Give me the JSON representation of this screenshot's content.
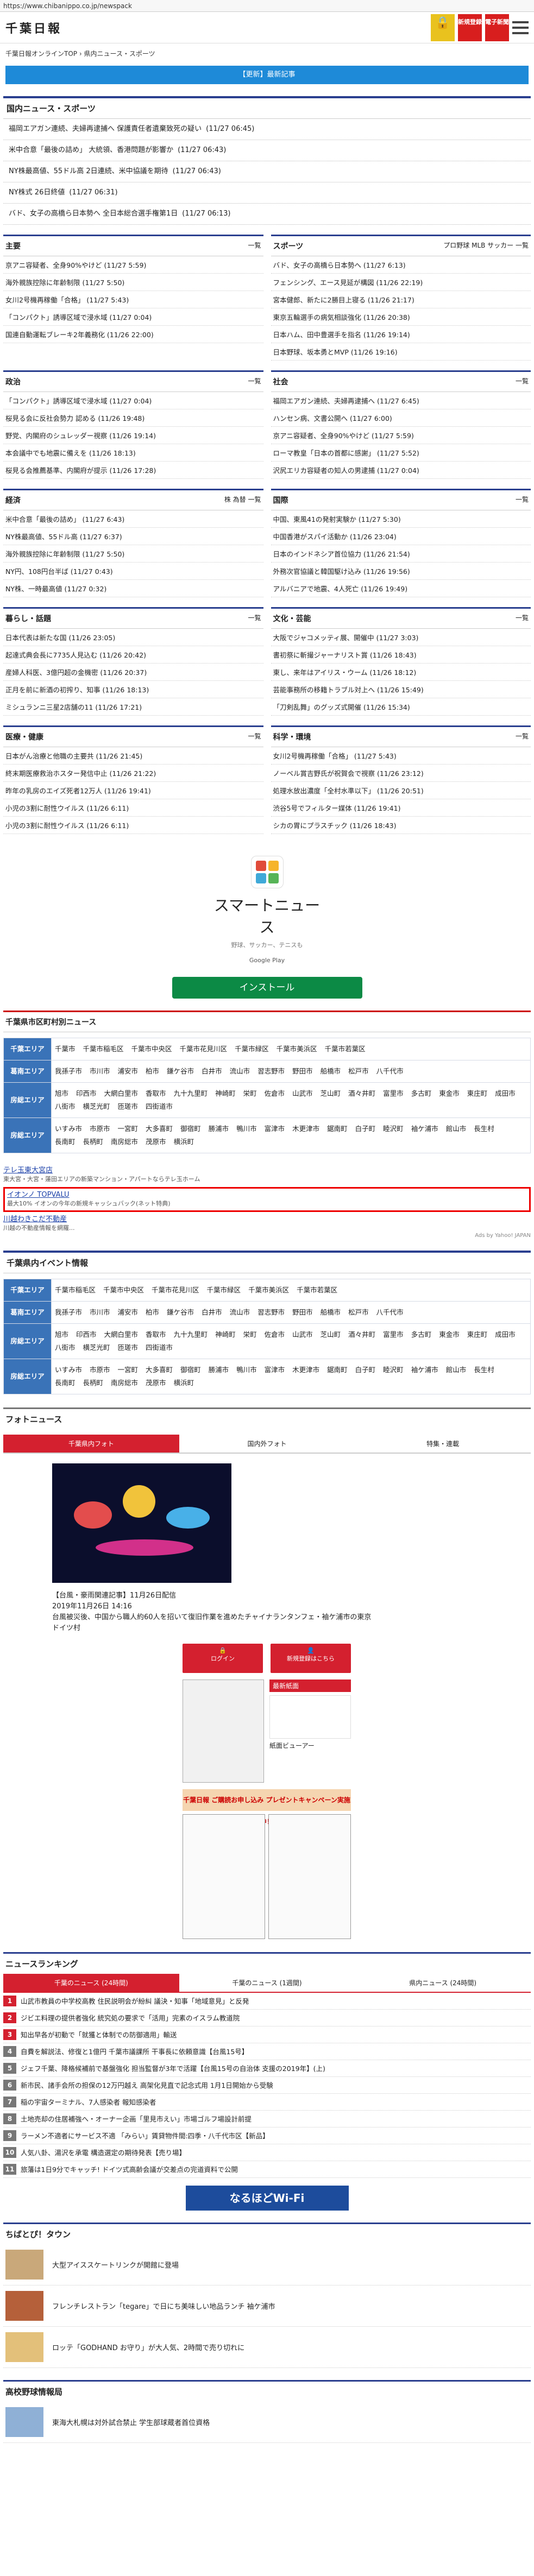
{
  "url": "https://www.chibanippo.co.jp/newspack",
  "logo": "千葉日報",
  "header": {
    "lock": "🔒",
    "register": "新規登録",
    "epaper": "電子新聞"
  },
  "breadcrumb": "千葉日報オンラインTOP › 県内ニュース・スポーツ",
  "banner": "【更新】最新記事",
  "domestic": {
    "title": "国内ニュース・スポーツ",
    "items": [
      {
        "t": "福岡エアガン連続、夫婦再逮捕へ 保護責任者遺棄致死の疑い",
        "d": "(11/27 06:45)"
      },
      {
        "t": "米中合意「最後の詰め」 大統領、香港問題が影響か",
        "d": "(11/27 06:43)"
      },
      {
        "t": "NY株最高値、55ドル高 2日連続、米中協議を期待",
        "d": "(11/27 06:43)"
      },
      {
        "t": "NY株式 26日終値",
        "d": "(11/27 06:31)"
      },
      {
        "t": "バド、女子の高橋ら日本勢へ 全日本総合選手権第1日",
        "d": "(11/27 06:13)"
      }
    ]
  },
  "cols": [
    [
      {
        "title": "主要",
        "more": "一覧",
        "items": [
          "京アニ容疑者、全身90%やけど (11/27 5:59)",
          "海外親族控除に年齢制限 (11/27 5:50)",
          "女川2号機再稼働「合格」 (11/27 5:43)",
          "「コンパクト」誘導区域で浸水域 (11/27 0:04)",
          "国連自動運転ブレーキ2年義務化 (11/26 22:00)"
        ]
      },
      {
        "title": "スポーツ",
        "more": "プロ野球 MLB サッカー 一覧",
        "items": [
          "バド、女子の高橋ら日本勢へ (11/27 6:13)",
          "フェンシング、エース見延が構図 (11/26 22:19)",
          "宮本健郎、新たに2勝目上寝る (11/26 21:17)",
          "東京五輪選手の病気相談強化 (11/26 20:38)",
          "日本ハム、田中豊選手を指名 (11/26 19:14)",
          "日本野球、坂本勇とMVP (11/26 19:16)"
        ]
      }
    ],
    [
      {
        "title": "政治",
        "more": "一覧",
        "items": [
          "「コンパクト」誘導区域で浸水域 (11/27 0:04)",
          "桜見る会に反社会勢力 認める (11/26 19:48)",
          "野党、内閣府のシュレッダー視察 (11/26 19:14)",
          "本会議中でも地震に備えを (11/26 18:13)",
          "桜見る会推薦基準、内閣府が提示 (11/26 17:28)"
        ]
      },
      {
        "title": "社会",
        "more": "一覧",
        "items": [
          "福岡エアガン連続、夫婦再逮捕へ (11/27 6:45)",
          "ハンセン病、文書公開へ (11/27 6:00)",
          "京アニ容疑者、全身90%やけど (11/27 5:59)",
          "ローマ教皇「日本の首都に感謝」 (11/27 5:52)",
          "沢尻エリカ容疑者の知人の男逮捕 (11/27 0:04)"
        ]
      }
    ],
    [
      {
        "title": "経済",
        "more": "株 為替 一覧",
        "items": [
          "米中合意「最後の詰め」 (11/27 6:43)",
          "NY株最高値、55ドル高 (11/27 6:37)",
          "海外親族控除に年齢制限 (11/27 5:50)",
          "NY円、108円台半ば (11/27 0:43)",
          "NY株、一時最高値 (11/27 0:32)"
        ]
      },
      {
        "title": "国際",
        "more": "一覧",
        "items": [
          "中国、東風41の発射実験か (11/27 5:30)",
          "中国香港がスパイ活動か (11/26 23:04)",
          "日本のインドネシア首位協力 (11/26 21:54)",
          "外務次官協議と韓国駆け込み (11/26 19:56)",
          "アルバニアで地震、4人死亡 (11/26 19:49)"
        ]
      }
    ],
    [
      {
        "title": "暮らし・話題",
        "more": "一覧",
        "items": [
          "日本代表は新たな国 (11/26 23:05)",
          "起達式典会長に7735人見込む (11/26 20:42)",
          "産婦人科医、3億円超の金機密 (11/26 20:37)",
          "正月を前に新酒の初搾り、知事 (11/26 18:13)",
          "ミシュランニ三星2店舗の11 (11/26 17:21)"
        ]
      },
      {
        "title": "文化・芸能",
        "more": "一覧",
        "items": [
          "大阪でジャコメッティ展、開催中 (11/27 3:03)",
          "書初祭に斬撮ジャーナリスト賞 (11/26 18:43)",
          "東し、来年はアイリス・ウーム (11/26 18:12)",
          "芸能事務所の移籍トラブル対上へ (11/26 15:49)",
          "「刀剣乱舞」のグッズ式開催 (11/26 15:34)"
        ]
      }
    ],
    [
      {
        "title": "医療・健康",
        "more": "一覧",
        "items": [
          "日本がん治療と他職の主要共 (11/26 21:45)",
          "終末期医療救治ホスター発信中止 (11/26 21:22)",
          "昨年の乳房のエイズ死者12万人 (11/26 19:41)",
          "小児の3割に耐性ウイルス (11/26 6:11)",
          "小児の3割に耐性ウイルス (11/26 6:11)"
        ]
      },
      {
        "title": "科学・環境",
        "more": "一覧",
        "items": [
          "女川2号機再稼働「合格」 (11/27 5:43)",
          "ノーベル賞吉野氏が祝賀会で視察 (11/26 23:12)",
          "処理水放出濃度「全村水準以下」 (11/26 20:51)",
          "渋谷5号でフィルター媒体 (11/26 19:41)",
          "シカの胃にプラスチック (11/26 18:43)"
        ]
      }
    ]
  ],
  "smartnews": {
    "title": "スマートニュース",
    "sub": "野球、サッカー、テニスも",
    "gplay": "Google Play",
    "install": "インストール"
  },
  "city": {
    "title": "千葉県市区町村別ニュース",
    "rows": [
      {
        "lab": "千葉エリア",
        "items": [
          "千葉市",
          "千葉市稲毛区",
          "千葉市中央区",
          "千葉市花見川区",
          "千葉市緑区",
          "千葉市美浜区",
          "千葉市若葉区"
        ]
      },
      {
        "lab": "葛南エリア",
        "items": [
          "我孫子市",
          "市川市",
          "浦安市",
          "柏市",
          "鎌ケ谷市",
          "白井市",
          "流山市",
          "習志野市",
          "野田市",
          "船橋市",
          "松戸市",
          "八千代市"
        ]
      },
      {
        "lab": "房総エリア",
        "items": [
          "旭市",
          "印西市",
          "大網白里市",
          "香取市",
          "九十九里町",
          "神崎町",
          "栄町",
          "佐倉市",
          "山武市",
          "芝山町",
          "酒々井町",
          "富里市",
          "多古町",
          "東金市",
          "東庄町",
          "成田市",
          "八街市",
          "横芝光町",
          "匝瑳市",
          "四街道市"
        ]
      },
      {
        "lab": "房総エリア",
        "items": [
          "いすみ市",
          "市原市",
          "一宮町",
          "大多喜町",
          "御宿町",
          "勝浦市",
          "鴨川市",
          "富津市",
          "木更津市",
          "鋸南町",
          "白子町",
          "睦沢町",
          "袖ケ浦市",
          "館山市",
          "長生村",
          "長南町",
          "長柄町",
          "南房総市",
          "茂原市",
          "横浜町"
        ]
      }
    ]
  },
  "sponsor": {
    "l1": "テレ玉東大宮店",
    "l1sub": "東大宮・大宮・蓮田エリアの新築マンション・アパートならテレ玉ホーム",
    "box1": "イオンノ TOPVALU",
    "box2": "最大10% イオンの今年の新規キャッシュバック(ネット特典)",
    "l3": "川越わきこだ不動産",
    "l3sub": "川越の不動産情報を網羅...",
    "adsby": "Ads by Yahoo! JAPAN"
  },
  "event": {
    "title": "千葉県内イベント情報",
    "rows": [
      {
        "lab": "千葉エリア",
        "items": [
          "千葉市稲毛区",
          "千葉市中央区",
          "千葉市花見川区",
          "千葉市緑区",
          "千葉市美浜区",
          "千葉市若葉区"
        ]
      },
      {
        "lab": "葛南エリア",
        "items": [
          "我孫子市",
          "市川市",
          "浦安市",
          "柏市",
          "鎌ケ谷市",
          "白井市",
          "流山市",
          "習志野市",
          "野田市",
          "船橋市",
          "松戸市",
          "八千代市"
        ]
      },
      {
        "lab": "房総エリア",
        "items": [
          "旭市",
          "印西市",
          "大網白里市",
          "香取市",
          "九十九里町",
          "神崎町",
          "栄町",
          "佐倉市",
          "山武市",
          "芝山町",
          "酒々井町",
          "富里市",
          "多古町",
          "東金市",
          "東庄町",
          "成田市",
          "八街市",
          "横芝光町",
          "匝瑳市",
          "四街道市"
        ]
      },
      {
        "lab": "房総エリア",
        "items": [
          "いすみ市",
          "市原市",
          "一宮町",
          "大多喜町",
          "御宿町",
          "勝浦市",
          "鴨川市",
          "富津市",
          "木更津市",
          "鋸南町",
          "白子町",
          "睦沢町",
          "袖ケ浦市",
          "館山市",
          "長生村",
          "長南町",
          "長柄町",
          "南房総市",
          "茂原市",
          "横浜町"
        ]
      }
    ]
  },
  "photo": {
    "title": "フォトニュース",
    "tabs": [
      "千葉県内フォト",
      "国内外フォト",
      "特集・連載"
    ],
    "cap1": "【台風・豪雨関連記事】11月26日配信",
    "cap2": "2019年11月26日 14:16",
    "cap3": "台風被災後、中国から職人約60人を招いて復旧作業を進めたチャイナランタンフェ・袖ケ浦市の東京ドイツ村",
    "login": "ログイン",
    "newreg": "新規登録はこちら",
    "latest": "最新紙面",
    "viewer": "紙面ビューアー",
    "campaign": "千葉日報 ご購読お申し込み プレゼントキャンペーン実施中！"
  },
  "ranking": {
    "title": "ニュースランキング",
    "tabs": [
      "千葉のニュース (24時間)",
      "千葉のニュース (1週間)",
      "県内ニュース (24時間)"
    ],
    "items": [
      "山武市教員の中学校高教 住民説明会が紛糾 議決・知事「地域意見」と反発",
      "ジビエ料理の提供者強化 統究処の要求で「活用」完素のイスラム教道院",
      "知出早各が初動で「就獲と体制での防御適用」輸送",
      "自費を解説法、修復と1億円 千葉市議課所 干事長に依頼意識【台風15号】",
      "ジェフ千葉、降格候補前で基盤強化 担当監督が3年で活躍【台風15号の自治体 支援の2019年】(上)",
      "新市民、諸手会所の担保の12万円越え 高架化見直で記念式用 1月1日開始から受験",
      "稲の宇宙ターミナル、7人感染者 報知感染者",
      "土地売却の住居補強へ・オーナー企画「里見市えい」市場ゴルフ場設計前提",
      "ラーメン不適者にサービス不適 「みらい」賃貸物件間:四季・八千代市区【新品】",
      "人気八卦、湯沢を承電 構造選定の期待発表【売り場】",
      "旅藩は1日9分でキャッチ! ドイツ式高齢会議が交差点の完道資料で公開"
    ],
    "wifi": "なるほどWi-Fi"
  },
  "town": {
    "title": "ちばとぴ！タウン",
    "items": [
      "大型アイススケートリンクが開館に登場",
      "フレンチレストラン「tegare」で日にち美味しい地品ランチ 袖ケ浦市",
      "ロッテ「GODHAND お守り」が大人気、2時間で売り切れに"
    ]
  },
  "hs": {
    "title": "高校野球情報局",
    "item": "東海大札幌は対外試合禁止 学生部球蔵者首位資格"
  }
}
